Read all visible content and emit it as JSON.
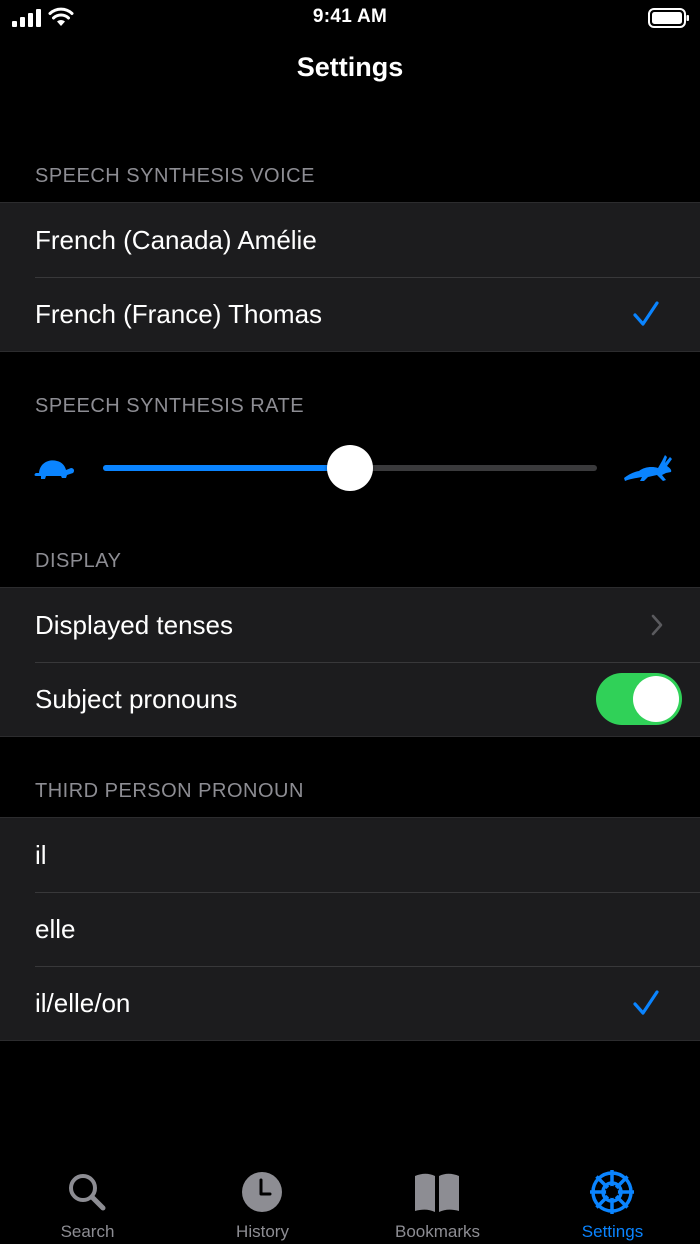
{
  "status_bar": {
    "time": "9:41 AM"
  },
  "nav": {
    "title": "Settings"
  },
  "voice_section": {
    "header": "SPEECH SYNTHESIS VOICE",
    "options": [
      {
        "label": "French (Canada) Amélie",
        "selected": false
      },
      {
        "label": "French (France) Thomas",
        "selected": true
      }
    ]
  },
  "rate_section": {
    "header": "SPEECH SYNTHESIS RATE",
    "slider_value": 0.5,
    "min_icon": "turtle-icon",
    "max_icon": "rabbit-icon"
  },
  "display_section": {
    "header": "DISPLAY",
    "displayed_tenses_label": "Displayed tenses",
    "subject_pronouns_label": "Subject pronouns",
    "subject_pronouns_on": true
  },
  "pronoun_section": {
    "header": "THIRD PERSON PRONOUN",
    "options": [
      {
        "label": "il",
        "selected": false
      },
      {
        "label": "elle",
        "selected": false
      },
      {
        "label": "il/elle/on",
        "selected": true
      }
    ]
  },
  "tabs": [
    {
      "label": "Search",
      "icon": "search-icon",
      "active": false
    },
    {
      "label": "History",
      "icon": "clock-icon",
      "active": false
    },
    {
      "label": "Bookmarks",
      "icon": "book-icon",
      "active": false
    },
    {
      "label": "Settings",
      "icon": "gear-icon",
      "active": true
    }
  ],
  "colors": {
    "accent": "#0a84ff",
    "toggle_on": "#30d158",
    "cell_background": "#1c1c1e",
    "secondary_text": "#8d8d93"
  }
}
